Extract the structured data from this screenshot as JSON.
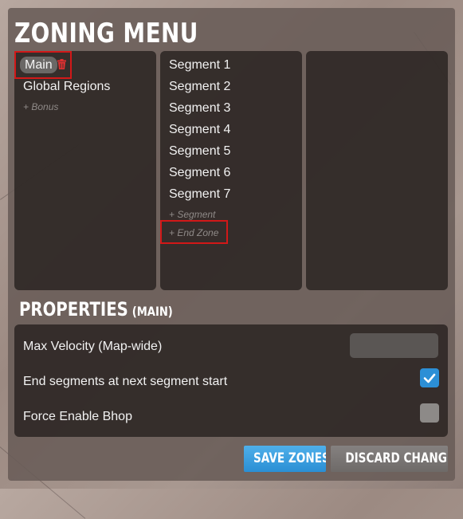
{
  "window": {
    "title": "Zoning Menu"
  },
  "tracks": {
    "items": [
      {
        "label": "Main",
        "selected": true
      },
      {
        "label": "Global Regions"
      }
    ],
    "add_label": "+ Bonus"
  },
  "segments": {
    "items": [
      "Segment 1",
      "Segment 2",
      "Segment 3",
      "Segment 4",
      "Segment 5",
      "Segment 6",
      "Segment 7"
    ],
    "add_segment_label": "+ Segment",
    "add_end_zone_label": "+ End Zone"
  },
  "properties": {
    "title": "Properties",
    "context": "(Main)",
    "max_velocity_label": "Max Velocity (Map-wide)",
    "max_velocity_value": "",
    "end_segments_label": "End segments at next segment start",
    "end_segments_checked": true,
    "force_bhop_label": "Force Enable Bhop",
    "force_bhop_checked": false
  },
  "buttons": {
    "save": "Save Zones",
    "discard": "Discard Changes"
  },
  "colors": {
    "accent": "#2c8fd6",
    "highlight": "#d21818",
    "delete": "#e03030"
  },
  "icons": {
    "delete": "trash-icon",
    "check": "checkmark-icon"
  }
}
